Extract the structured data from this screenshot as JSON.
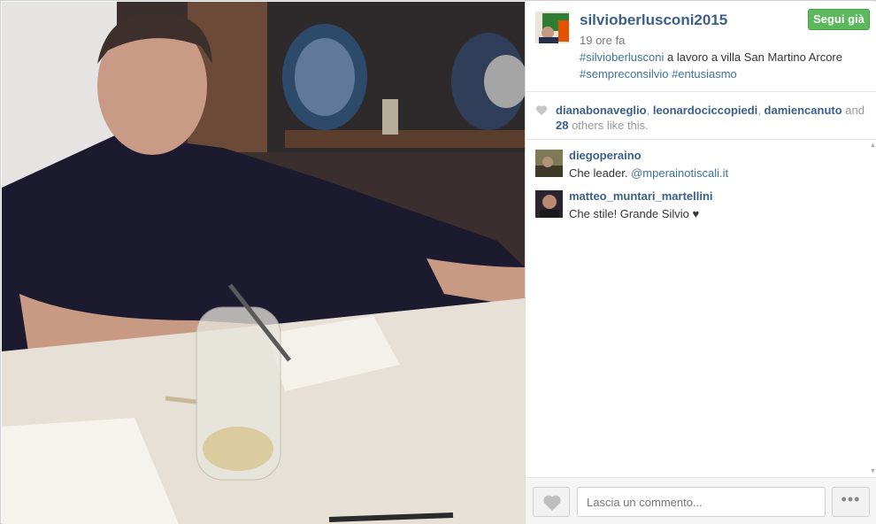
{
  "post": {
    "username": "silvioberlusconi2015",
    "follow_label": "Segui già",
    "time_ago": "19 ore fa",
    "caption": {
      "tag1": "#silvioberlusconi",
      "text": " a lavoro a villa San Martino Arcore",
      "tag2": "#sempreconsilvio",
      "tag3": "#entusiasmo"
    }
  },
  "likes": {
    "user1": "dianabonaveglio",
    "sep1": ", ",
    "user2": "leonardociccopiedi",
    "sep2": ", ",
    "user3": "damiencanuto",
    "and": " and",
    "count": "28",
    "suffix": " others like this."
  },
  "comments": [
    {
      "user": "diegoperaino",
      "text": "Che leader. ",
      "mention": "@mperainotiscali.it"
    },
    {
      "user": "matteo_muntari_martellini",
      "text": "Che stile! Grande Silvio ♥"
    }
  ],
  "footer": {
    "comment_placeholder": "Lascia un commento...",
    "more_label": "•••"
  },
  "colors": {
    "link": "#3f729b",
    "username": "#3b5f8a",
    "follow_green": "#5cb85c"
  },
  "icons": {
    "like": "heart-icon",
    "more": "ellipsis-icon"
  }
}
